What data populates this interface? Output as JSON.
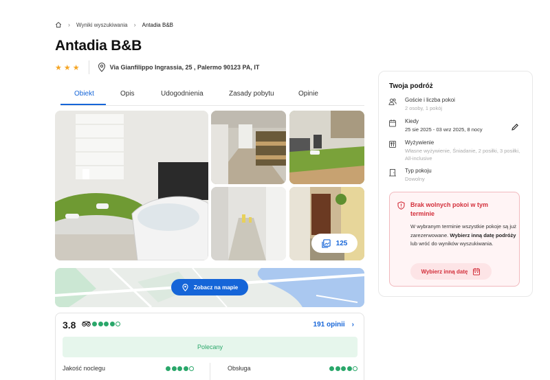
{
  "breadcrumb": {
    "home_icon": "home-icon",
    "items": [
      "Wyniki wyszukiwania",
      "Antadia B&B"
    ]
  },
  "hotel": {
    "name": "Antadia B&B",
    "stars": 3,
    "address": "Via Gianfilippo Ingrassia, 25 , Palermo 90123 PA, IT"
  },
  "tabs": [
    {
      "label": "Obiekt",
      "active": true
    },
    {
      "label": "Opis",
      "active": false
    },
    {
      "label": "Udogodnienia",
      "active": false
    },
    {
      "label": "Zasady pobytu",
      "active": false
    },
    {
      "label": "Opinie",
      "active": false
    }
  ],
  "gallery": {
    "photo_count": "125",
    "icon": "gallery-icon"
  },
  "map": {
    "button_label": "Zobacz na mapie",
    "icon": "location-pin-icon"
  },
  "reviews": {
    "score": "3.8",
    "rating_dots": 4,
    "rating_icon": "tripadvisor-icon",
    "count_label": "191 opinii",
    "recommendation": "Polecany",
    "categories": [
      {
        "label": "Jakość noclegu",
        "dots": 4
      },
      {
        "label": "Obsługa",
        "dots": 4
      }
    ]
  },
  "trip": {
    "title": "Twoja podróż",
    "guests": {
      "label": "Goście i liczba pokoi",
      "value": "2 osoby, 1 pokój",
      "icon": "guests-icon"
    },
    "when": {
      "label": "Kiedy",
      "value": "25 sie 2025 - 03 wrz 2025, 8 nocy",
      "icon": "calendar-icon",
      "edit_icon": "pencil-icon"
    },
    "board": {
      "label": "Wyżywienie",
      "value": "Własne wyżywienie, Śniadanie, 2 posiłki, 3 posiłki, All-inclusive",
      "icon": "cutlery-icon"
    },
    "room": {
      "label": "Typ pokoju",
      "value": "Dowolny",
      "icon": "door-icon"
    }
  },
  "alert": {
    "title": "Brak wolnych pokoi w tym terminie",
    "body_1": "W wybranym terminie wszystkie pokoje są już zarezerwowane.",
    "body_bold": "Wybierz inną datę podróży",
    "body_2": " lub wróć do wyników wyszukiwania.",
    "button_label": "Wybierz inną datę",
    "icon": "shield-alert-icon",
    "button_icon": "calendar-icon"
  },
  "colors": {
    "accent": "#1565d8",
    "star": "#f5a524",
    "rating": "#2aa76a",
    "alert": "#d32f3b"
  }
}
